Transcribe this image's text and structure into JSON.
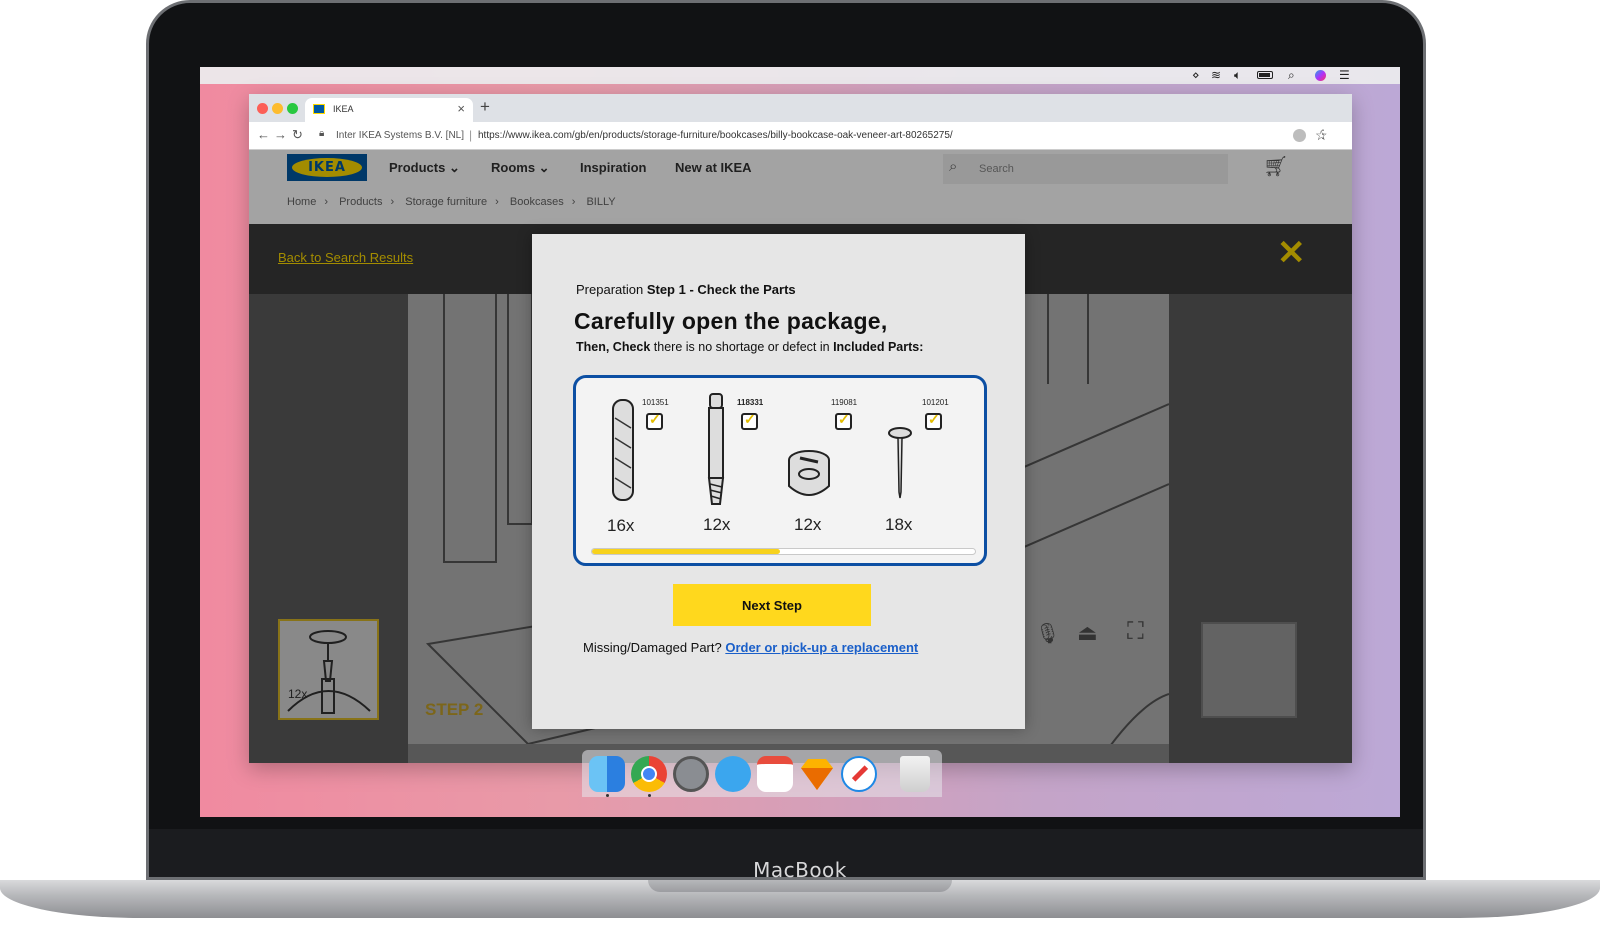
{
  "laptop": {
    "brand": "MacBook"
  },
  "menubar": {
    "icons": [
      "apple-icon",
      "cast-icon",
      "wifi-icon",
      "volume-icon",
      "battery-icon",
      "spotlight-icon",
      "siri-icon",
      "notification-center-icon"
    ]
  },
  "browser": {
    "tab_title": "IKEA",
    "site_identity": "Inter IKEA Systems B.V. [NL]",
    "url": "https://www.ikea.com/gb/en/products/storage-furniture/bookcases/billy-bookcase-oak-veneer-art-80265275/"
  },
  "ikea": {
    "logo_text": "IKEA",
    "nav": [
      "Products",
      "Rooms",
      "Inspiration",
      "New at IKEA"
    ],
    "search_placeholder": "Search",
    "breadcrumb": [
      "Home",
      "Products",
      "Storage furniture",
      "Bookcases",
      "BILLY"
    ]
  },
  "viewer": {
    "back_link": "Back to Search Results",
    "thumb_count": "12x",
    "step_label": "STEP 2"
  },
  "modal": {
    "prep_prefix": "Preparation ",
    "prep_step": "Step 1 - Check the Parts",
    "heading": "Carefully open the package,",
    "sub_b1": "Then, Check",
    "sub_mid": " there is no shortage or defect in ",
    "sub_b2": "Included Parts:",
    "parts": [
      {
        "code": "101351",
        "qty": "16x",
        "checked": true
      },
      {
        "code": "118331",
        "qty": "12x",
        "checked": true
      },
      {
        "code": "119081",
        "qty": "12x",
        "checked": true
      },
      {
        "code": "101201",
        "qty": "18x",
        "checked": true
      }
    ],
    "progress": 0.49,
    "next_button": "Next Step",
    "missing_text": "Missing/Damaged Part? ",
    "replacement_link": "Order or pick-up a replacement"
  },
  "dock": {
    "apps": [
      "finder",
      "chrome",
      "system-preferences",
      "messages",
      "calendar",
      "sketch",
      "safari",
      "trash"
    ]
  }
}
